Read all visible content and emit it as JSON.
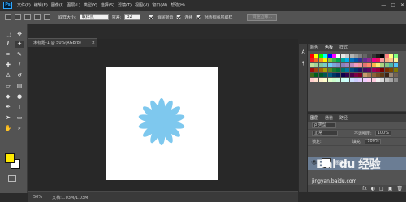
{
  "app": {
    "logo": "Ps"
  },
  "menu": [
    "文件(F)",
    "编辑(E)",
    "图像(I)",
    "图层(L)",
    "类型(Y)",
    "选择(S)",
    "滤镜(T)",
    "视图(V)",
    "窗口(W)",
    "帮助(H)"
  ],
  "window_controls": {
    "minimize": "—",
    "maximize": "□",
    "close": "✕"
  },
  "options_bar": {
    "sample_size_label": "取样大小:",
    "sample_size_value": "取样点",
    "tolerance_label": "容差:",
    "tolerance_value": "32",
    "antialias_label": "消除锯齿",
    "antialias_checked": true,
    "contiguous_label": "连续",
    "contiguous_checked": true,
    "all_layers_label": "对所有图层取样",
    "all_layers_checked": false,
    "refine_edge_label": "调整边缘..."
  },
  "document": {
    "tab_title": "未标题-1 @ 50%(RGB/8)",
    "tab_close": "×",
    "canvas_color": "#ffffff",
    "flower_color": "#7ec8ee",
    "flower_petals": 14
  },
  "status_bar": {
    "zoom": "50%",
    "doc_info": "文档:1.03M/1.03M"
  },
  "colors": {
    "foreground": "#ffea00",
    "background": "#ffffff",
    "accent": "#31a8ff"
  },
  "swatch_panel": {
    "tabs": [
      "颜色",
      "色板",
      "样式"
    ],
    "active_tab": "色板",
    "rows": [
      [
        "#ff0000",
        "#ffff00",
        "#00ff00",
        "#00ffff",
        "#0000ff",
        "#ff00ff",
        "#ffffff",
        "#e6e6e6",
        "#cccccc",
        "#b3b3b3",
        "#999999",
        "#808080",
        "#666666",
        "#4d4d4d",
        "#333333",
        "#1a1a1a",
        "#000000",
        "#ff8080",
        "#ffff80",
        "#80ff80"
      ],
      [
        "#ee1c24",
        "#f26522",
        "#f7941d",
        "#fff200",
        "#8dc63f",
        "#39b54a",
        "#00a651",
        "#00a99d",
        "#00aeef",
        "#0072bc",
        "#0054a6",
        "#2e3192",
        "#662d91",
        "#92278f",
        "#ec008c",
        "#ed145b",
        "#f5989d",
        "#f9ad81",
        "#fdc68a",
        "#fff799"
      ],
      [
        "#c4df9b",
        "#a3d39c",
        "#82ca9c",
        "#7accc8",
        "#6dcff6",
        "#7da7d9",
        "#8393ca",
        "#8781bd",
        "#a186be",
        "#bd8cbf",
        "#f49ac1",
        "#f6989d",
        "#e57373",
        "#ff8a65",
        "#ffb74d",
        "#fff176",
        "#aed581",
        "#81c784",
        "#4db6ac",
        "#4fc3f7"
      ],
      [
        "#9e0b0f",
        "#a0410d",
        "#a36209",
        "#aba000",
        "#598527",
        "#197b30",
        "#007236",
        "#00746b",
        "#0076a3",
        "#004b80",
        "#003471",
        "#1b1464",
        "#440e62",
        "#630460",
        "#9e005d",
        "#9e0039",
        "#790000",
        "#7b2e00",
        "#7d4900",
        "#827b00"
      ],
      [
        "#406618",
        "#005e20",
        "#005826",
        "#005952",
        "#005b7f",
        "#003663",
        "#002157",
        "#0d004c",
        "#32004b",
        "#4b0049",
        "#7b0046",
        "#7a0026",
        "#c69c6d",
        "#a67c52",
        "#8c6239",
        "#754c24",
        "#603913",
        "#3c2415",
        "#998675",
        "#736357"
      ],
      [
        "#ffcccc",
        "#ffe0cc",
        "#fff0cc",
        "#ffffcc",
        "#e0ffcc",
        "#ccffcc",
        "#ccffe0",
        "#ccfff0",
        "#ccffff",
        "#cce0ff",
        "#ccccff",
        "#e0ccff",
        "#f0ccff",
        "#ffccf0",
        "#ffcce0",
        "#f2f2f2",
        "#d9d9d9",
        "#bfbfbf",
        "#a6a6a6",
        "#8c8c8c"
      ]
    ]
  },
  "layers_panel": {
    "tabs": [
      "图层",
      "通道",
      "路径"
    ],
    "filter_label": "ρ 类型",
    "blend_mode": "正常",
    "opacity_label": "不透明度:",
    "opacity_value": "100%",
    "lock_label": "锁定:",
    "fill_label": "填充:",
    "fill_value": "100%",
    "layer_name": "图层 0",
    "bottom_icons": [
      "fx",
      "◐",
      "□",
      "▣",
      "🗑"
    ]
  },
  "watermark": {
    "logo": "Bai du 经验",
    "url": "jingyan.baidu.com"
  },
  "icons": {
    "toolbar": [
      "move-icon",
      "marquee-icon",
      "lasso-icon",
      "magic-wand-icon",
      "crop-icon",
      "eyedropper-icon",
      "healing-brush-icon",
      "brush-icon",
      "clone-stamp-icon",
      "history-brush-icon",
      "eraser-icon",
      "gradient-icon",
      "blur-icon",
      "dodge-icon",
      "pen-icon",
      "type-icon",
      "path-selection-icon",
      "shape-icon",
      "hand-icon",
      "zoom-icon"
    ]
  }
}
